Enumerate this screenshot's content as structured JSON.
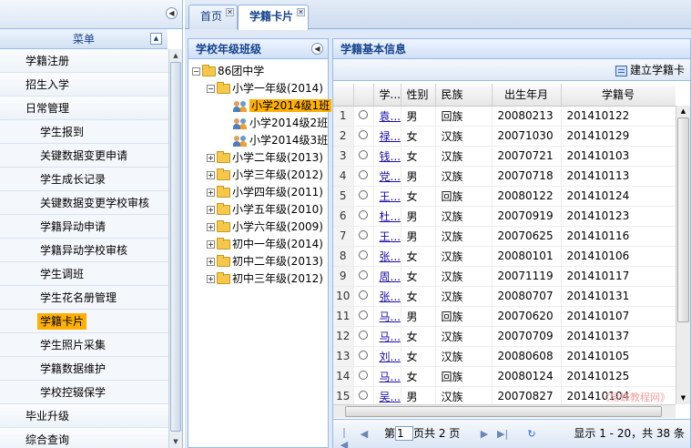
{
  "menu": {
    "title": "菜单",
    "items": [
      {
        "label": "学籍注册",
        "level": 1
      },
      {
        "label": "招生入学",
        "level": 1
      },
      {
        "label": "日常管理",
        "level": 1
      },
      {
        "label": "学生报到",
        "level": 2
      },
      {
        "label": "关键数据变更申请",
        "level": 2
      },
      {
        "label": "学生成长记录",
        "level": 2
      },
      {
        "label": "关键数据变更学校审核",
        "level": 2
      },
      {
        "label": "学籍异动申请",
        "level": 2
      },
      {
        "label": "学籍异动学校审核",
        "level": 2
      },
      {
        "label": "学生调班",
        "level": 2
      },
      {
        "label": "学生花名册管理",
        "level": 2
      },
      {
        "label": "学籍卡片",
        "level": 2,
        "selected": true
      },
      {
        "label": "学生照片采集",
        "level": 2
      },
      {
        "label": "学籍数据维护",
        "level": 2
      },
      {
        "label": "学校控辍保学",
        "level": 2
      },
      {
        "label": "毕业升级",
        "level": 1
      },
      {
        "label": "综合查询",
        "level": 1
      }
    ]
  },
  "tabs": [
    {
      "label": "首页"
    },
    {
      "label": "学籍卡片",
      "active": true
    }
  ],
  "tree": {
    "title": "学校年级班级",
    "nodes": [
      {
        "label": "86团中学",
        "depth": 0,
        "toggle": "−",
        "icon": "folder"
      },
      {
        "label": "小学一年级(2014)",
        "depth": 1,
        "toggle": "−",
        "icon": "folder"
      },
      {
        "label": "小学2014级1班",
        "depth": 2,
        "icon": "users",
        "selected": true
      },
      {
        "label": "小学2014级2班",
        "depth": 2,
        "icon": "users"
      },
      {
        "label": "小学2014级3班",
        "depth": 2,
        "icon": "users"
      },
      {
        "label": "小学二年级(2013)",
        "depth": 1,
        "toggle": "+",
        "icon": "folder"
      },
      {
        "label": "小学三年级(2012)",
        "depth": 1,
        "toggle": "+",
        "icon": "folder"
      },
      {
        "label": "小学四年级(2011)",
        "depth": 1,
        "toggle": "+",
        "icon": "folder"
      },
      {
        "label": "小学五年级(2010)",
        "depth": 1,
        "toggle": "+",
        "icon": "folder"
      },
      {
        "label": "小学六年级(2009)",
        "depth": 1,
        "toggle": "+",
        "icon": "folder"
      },
      {
        "label": "初中一年级(2014)",
        "depth": 1,
        "toggle": "+",
        "icon": "folder"
      },
      {
        "label": "初中二年级(2013)",
        "depth": 1,
        "toggle": "+",
        "icon": "folder"
      },
      {
        "label": "初中三年级(2012)",
        "depth": 1,
        "toggle": "+",
        "icon": "folder"
      }
    ]
  },
  "grid": {
    "title": "学籍基本信息",
    "new_button": "建立学籍卡",
    "columns": [
      "学...",
      "性别",
      "民族",
      "出生年月",
      "学籍号"
    ],
    "rows": [
      {
        "n": "1",
        "name": "袁...",
        "sex": "男",
        "nation": "回族",
        "birth": "20080213",
        "id": "201410122"
      },
      {
        "n": "2",
        "name": "禄...",
        "sex": "女",
        "nation": "汉族",
        "birth": "20071030",
        "id": "201410129"
      },
      {
        "n": "3",
        "name": "钱...",
        "sex": "女",
        "nation": "汉族",
        "birth": "20070721",
        "id": "201410103"
      },
      {
        "n": "4",
        "name": "党...",
        "sex": "男",
        "nation": "汉族",
        "birth": "20070718",
        "id": "201410113"
      },
      {
        "n": "5",
        "name": "王...",
        "sex": "女",
        "nation": "回族",
        "birth": "20080122",
        "id": "201410124"
      },
      {
        "n": "6",
        "name": "杜...",
        "sex": "男",
        "nation": "汉族",
        "birth": "20070919",
        "id": "201410123"
      },
      {
        "n": "7",
        "name": "王...",
        "sex": "男",
        "nation": "汉族",
        "birth": "20070625",
        "id": "201410116"
      },
      {
        "n": "8",
        "name": "张...",
        "sex": "女",
        "nation": "汉族",
        "birth": "20080101",
        "id": "201410106"
      },
      {
        "n": "9",
        "name": "周...",
        "sex": "女",
        "nation": "汉族",
        "birth": "20071119",
        "id": "201410117"
      },
      {
        "n": "10",
        "name": "张...",
        "sex": "女",
        "nation": "汉族",
        "birth": "20080707",
        "id": "201410131"
      },
      {
        "n": "11",
        "name": "马...",
        "sex": "男",
        "nation": "回族",
        "birth": "20070620",
        "id": "201410107"
      },
      {
        "n": "12",
        "name": "马...",
        "sex": "女",
        "nation": "汉族",
        "birth": "20070709",
        "id": "201410137"
      },
      {
        "n": "13",
        "name": "刘...",
        "sex": "女",
        "nation": "汉族",
        "birth": "20080608",
        "id": "201410105"
      },
      {
        "n": "14",
        "name": "马...",
        "sex": "女",
        "nation": "回族",
        "birth": "20080124",
        "id": "201410125"
      },
      {
        "n": "15",
        "name": "吴...",
        "sex": "男",
        "nation": "汉族",
        "birth": "20070827",
        "id": "201410104"
      }
    ]
  },
  "pager": {
    "page_prefix": "第",
    "page_value": "1",
    "page_suffix": "页共 2 页",
    "summary": "显示 1 - 20，共 38 条"
  },
  "watermark": "《易蜂教程网》"
}
